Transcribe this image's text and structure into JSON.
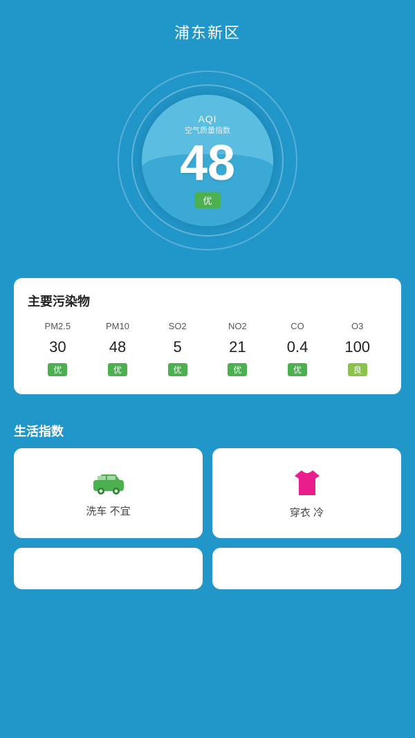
{
  "header": {
    "title": "浦东新区"
  },
  "aqi": {
    "label": "AQI",
    "sublabel": "空气质量指数",
    "value": "48",
    "badge": "优"
  },
  "pollutants": {
    "section_title": "主要污染物",
    "items": [
      {
        "name": "PM2.5",
        "value": "30",
        "badge": "优",
        "badge_class": "badge-good"
      },
      {
        "name": "PM10",
        "value": "48",
        "badge": "优",
        "badge_class": "badge-good"
      },
      {
        "name": "SO2",
        "value": "5",
        "badge": "优",
        "badge_class": "badge-good"
      },
      {
        "name": "NO2",
        "value": "21",
        "badge": "优",
        "badge_class": "badge-good"
      },
      {
        "name": "CO",
        "value": "0.4",
        "badge": "优",
        "badge_class": "badge-good"
      },
      {
        "name": "O3",
        "value": "100",
        "badge": "良",
        "badge_class": "badge-moderate"
      }
    ]
  },
  "life_index": {
    "section_title": "生活指数",
    "items": [
      {
        "id": "car-wash",
        "label": "洗车 不宜"
      },
      {
        "id": "clothing",
        "label": "穿衣 冷"
      }
    ]
  },
  "colors": {
    "background": "#2196c9",
    "good_green": "#4caf50",
    "moderate_green": "#8bc34a",
    "car_color": "#4caf50",
    "shirt_color": "#e91e8c"
  }
}
